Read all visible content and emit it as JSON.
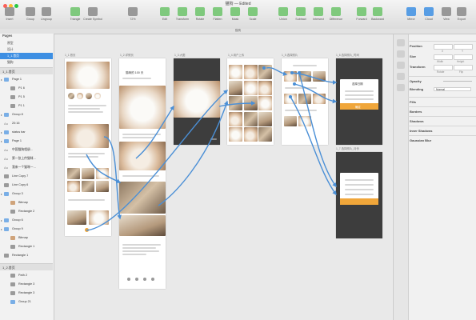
{
  "window": {
    "title": "猫狗 — Edited",
    "subtitle": "猫狗"
  },
  "toolbar": {
    "items": [
      {
        "label": "Insert",
        "icon": "plus-icon"
      },
      {
        "label": "Group",
        "icon": "group-icon"
      },
      {
        "label": "Ungroup",
        "icon": "ungroup-icon"
      },
      {
        "label": "Triangle",
        "icon": "triangle-icon"
      },
      {
        "label": "Create Symbol",
        "icon": "symbol-icon"
      },
      {
        "label": "72%",
        "icon": "zoom-icon"
      },
      {
        "label": "Edit",
        "icon": "edit-icon"
      },
      {
        "label": "Transform",
        "icon": "transform-icon"
      },
      {
        "label": "Rotate",
        "icon": "rotate-icon"
      },
      {
        "label": "Flatten",
        "icon": "flatten-icon"
      },
      {
        "label": "Mask",
        "icon": "mask-icon"
      },
      {
        "label": "Scale",
        "icon": "scale-icon"
      },
      {
        "label": "Union",
        "icon": "union-icon"
      },
      {
        "label": "Subtract",
        "icon": "subtract-icon"
      },
      {
        "label": "Intersect",
        "icon": "intersect-icon"
      },
      {
        "label": "Difference",
        "icon": "difference-icon"
      },
      {
        "label": "Forward",
        "icon": "forward-icon"
      },
      {
        "label": "Backward",
        "icon": "backward-icon"
      },
      {
        "label": "Mirror",
        "icon": "mirror-icon"
      },
      {
        "label": "Cloud",
        "icon": "cloud-icon"
      },
      {
        "label": "View",
        "icon": "view-icon"
      },
      {
        "label": "Export",
        "icon": "export-icon"
      }
    ],
    "colors": {
      "accent": "#3d8fe3",
      "green": "#6cc36a",
      "purple": "#b07bd6",
      "orange": "#f0a63a"
    }
  },
  "sidebar": {
    "pages_label": "Pages",
    "pages": [
      {
        "label": "原型",
        "selected": false
      },
      {
        "label": "设计",
        "selected": false
      },
      {
        "label": "1_1.首页",
        "selected": true
      },
      {
        "label": "猫狗",
        "selected": false
      }
    ],
    "section_label": "1_1.首页",
    "layers": [
      {
        "label": "Page 1",
        "icon": "folder",
        "indent": 0
      },
      {
        "label": "P1 6",
        "icon": "shape",
        "indent": 1
      },
      {
        "label": "P1 5",
        "icon": "shape",
        "indent": 1
      },
      {
        "label": "P1 1",
        "icon": "shape",
        "indent": 1
      },
      {
        "label": "Group 8",
        "icon": "folder",
        "indent": 0
      },
      {
        "label": "20:16",
        "icon": "text",
        "indent": 0
      },
      {
        "label": "status bar",
        "icon": "folder",
        "indent": 0
      },
      {
        "label": "Page 1",
        "icon": "folder",
        "indent": 0
      },
      {
        "label": "中国猫狗相册...",
        "icon": "text",
        "indent": 0
      },
      {
        "label": "第一张上传猫咪...",
        "icon": "text",
        "indent": 0
      },
      {
        "label": "我来一个猫咪一...",
        "icon": "text",
        "indent": 0
      },
      {
        "label": "Line Copy 7",
        "icon": "shape",
        "indent": 0
      },
      {
        "label": "Line Copy 6",
        "icon": "shape",
        "indent": 0
      },
      {
        "label": "Group 3",
        "icon": "folder",
        "indent": 0
      },
      {
        "label": "Bitmap",
        "icon": "bitmap",
        "indent": 1
      },
      {
        "label": "Rectangle 2",
        "icon": "shape",
        "indent": 1
      },
      {
        "label": "Group 6",
        "icon": "folder",
        "indent": 0
      },
      {
        "label": "Group 9",
        "icon": "folder",
        "indent": 0
      },
      {
        "label": "Bitmap",
        "icon": "bitmap",
        "indent": 1
      },
      {
        "label": "Rectangle 1",
        "icon": "shape",
        "indent": 1
      },
      {
        "label": "Rectangle 1",
        "icon": "shape",
        "indent": 0
      }
    ],
    "section2_label": "1_2.首页",
    "layers2": [
      {
        "label": "Path 2",
        "icon": "shape"
      },
      {
        "label": "Rectangle 3",
        "icon": "shape"
      },
      {
        "label": "Rectangle 3",
        "icon": "shape"
      },
      {
        "label": "Group 21",
        "icon": "folder"
      }
    ]
  },
  "artboards": [
    {
      "label": "1_1.首页"
    },
    {
      "label": "1_2.详情页"
    },
    {
      "label": "1_3.大图"
    },
    {
      "label": "1_4.用户上传"
    },
    {
      "label": "1_5.选择照片"
    },
    {
      "label": "1_6.选择照片_时间"
    },
    {
      "label": "1_7.选择照片_月份"
    }
  ],
  "artboard_text": {
    "detail_title": "猫咪的 100 天",
    "picker_title": "选择日期",
    "confirm_label": "确定"
  },
  "inspector": {
    "position_label": "Position",
    "x_label": "X",
    "y_label": "Y",
    "size_label": "Size",
    "width_label": "Width",
    "height_label": "Height",
    "transform_label": "Transform",
    "rotate_label": "Rotate",
    "flip_label": "Flip",
    "opacity_label": "Opacity",
    "blending_label": "Blending",
    "blending_value": "Normal",
    "fills_label": "Fills",
    "borders_label": "Borders",
    "shadows_label": "Shadows",
    "inner_shadows_label": "Inner Shadows",
    "gaussian_blur_label": "Gaussian Blur"
  }
}
